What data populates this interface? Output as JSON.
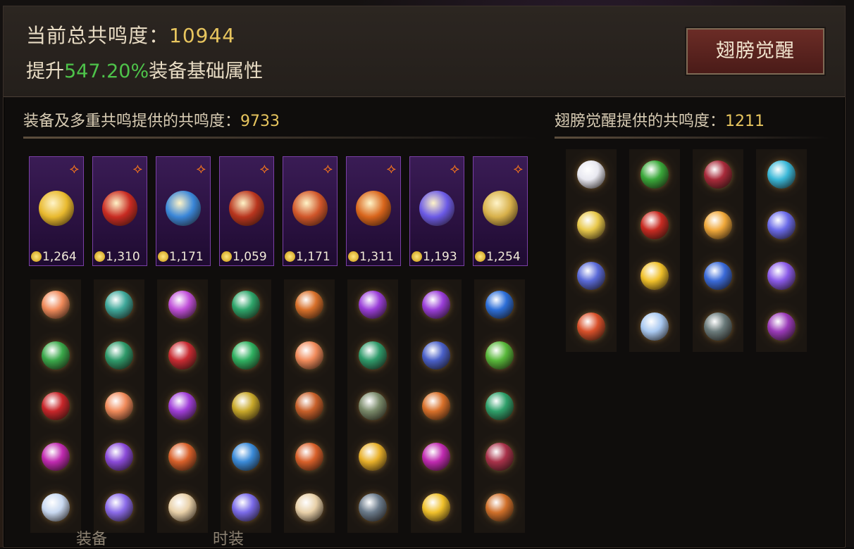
{
  "header": {
    "total_label": "当前总共鸣度：",
    "total_value": "10944",
    "boost_prefix": "提升",
    "boost_pct": "547.20%",
    "boost_suffix": "装备基础属性",
    "awaken_button": "翅膀觉醒"
  },
  "equipment_section": {
    "label": "装备及多重共鸣提供的共鸣度：",
    "value": "9733",
    "items": [
      {
        "score": "1,264",
        "color": "#e8b92e"
      },
      {
        "score": "1,310",
        "color": "#c82b22"
      },
      {
        "score": "1,171",
        "color": "#3a86d8"
      },
      {
        "score": "1,059",
        "color": "#b8351e"
      },
      {
        "score": "1,171",
        "color": "#d0562a"
      },
      {
        "score": "1,311",
        "color": "#d8651c"
      },
      {
        "score": "1,193",
        "color": "#6b5ae6"
      },
      {
        "score": "1,254",
        "color": "#d7b04a"
      }
    ],
    "gem_colors": [
      [
        "#f08a5a",
        "#3fa89a",
        "#c04fd8",
        "#2ea56a",
        "#d8702a",
        "#9a3ed8",
        "#9a3ed8",
        "#2d6fd8"
      ],
      [
        "#3aa84a",
        "#2f9a6a",
        "#c82b32",
        "#2fb060",
        "#f08a5a",
        "#2f9a6a",
        "#4a60c8",
        "#58b83a"
      ],
      [
        "#c8262a",
        "#f08a5a",
        "#a03ed8",
        "#c8a82a",
        "#c8602a",
        "#7a8a6a",
        "#d8702a",
        "#2fa06a"
      ],
      [
        "#c02ab0",
        "#8a4ad8",
        "#d8602a",
        "#3a8ad8",
        "#d8602a",
        "#e8b02a",
        "#c02ab0",
        "#a8324a"
      ],
      [
        "#c8d8f0",
        "#8a6ae8",
        "#e8d0a8",
        "#7a6ae8",
        "#e8d0a8",
        "#6a7a8a",
        "#f0c02a",
        "#d0702a"
      ]
    ]
  },
  "wing_section": {
    "label": "翅膀觉醒提供的共鸣度：",
    "value": "1211",
    "gem_colors": [
      [
        "#e8e8f0",
        "#3aa83a",
        "#a82a3a",
        "#3ab8d8"
      ],
      [
        "#e8c84a",
        "#c82b22",
        "#f0a83a",
        "#6a6ae8"
      ],
      [
        "#5a6ad8",
        "#f0c02a",
        "#3a6ad8",
        "#8a5ae8"
      ],
      [
        "#d8502a",
        "#a8c8f0",
        "#6a7a7a",
        "#9a3ab8"
      ]
    ]
  },
  "bottom_tabs": [
    "装备",
    "时装"
  ]
}
